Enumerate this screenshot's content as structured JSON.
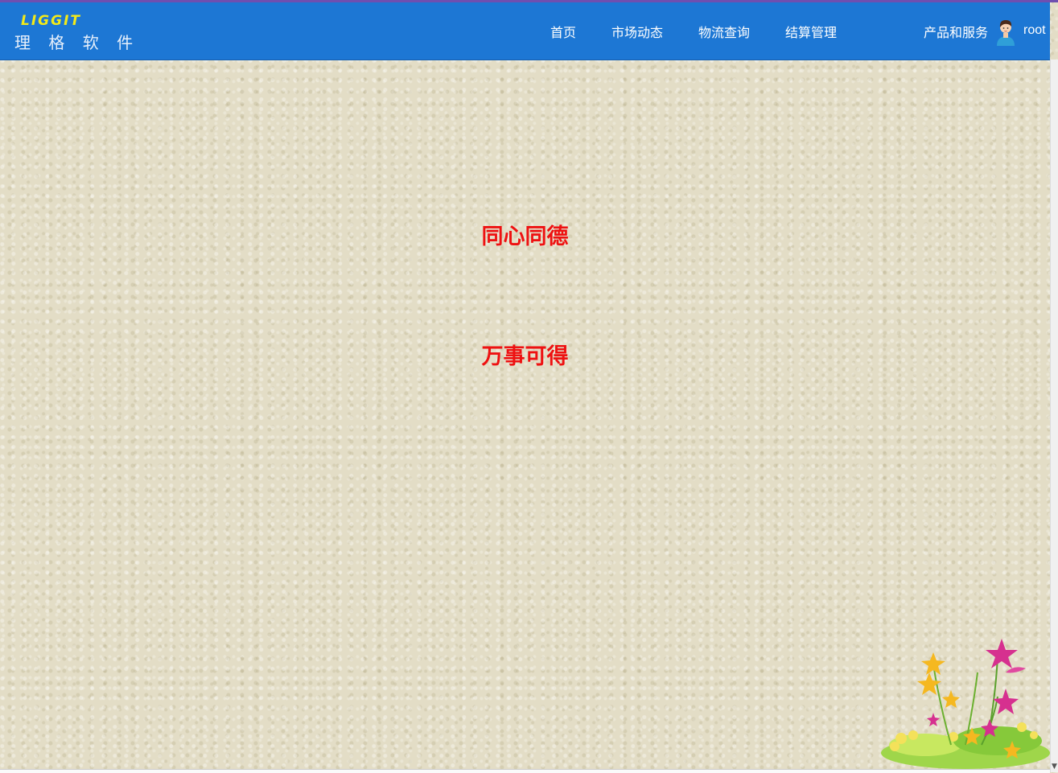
{
  "brand": {
    "name_en": "LIGGIT",
    "name_cn": "理 格 软 件"
  },
  "nav": {
    "items": [
      {
        "label": "首页"
      },
      {
        "label": "市场动态"
      },
      {
        "label": "物流查询"
      },
      {
        "label": "结算管理"
      },
      {
        "label": "产品和服务"
      }
    ]
  },
  "user": {
    "name": "root",
    "icon": "user-avatar-icon"
  },
  "main": {
    "slogan_line1": "同心同德",
    "slogan_line2": "万事可得"
  },
  "colors": {
    "navbar": "#1d77d4",
    "logo_en": "#f3ea18",
    "slogan": "#ee1111",
    "background": "#e3ddc6"
  }
}
